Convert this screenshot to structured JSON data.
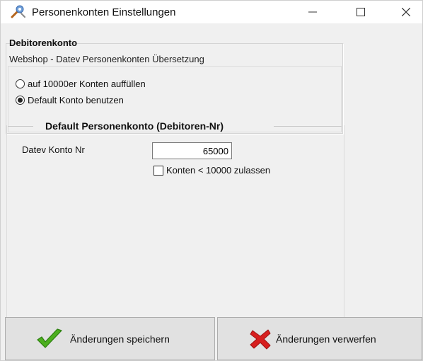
{
  "window": {
    "title": "Personenkonten Einstellungen",
    "icon": "wrench-settings-icon",
    "controls": {
      "minimize": "—",
      "maximize": "☐",
      "close": "✕"
    }
  },
  "debitor_group": {
    "title": "Debitorenkonto",
    "subtitle": "Webshop - Datev Personenkonten Übersetzung",
    "options": [
      {
        "label": "auf 10000er Konten auffüllen",
        "checked": false
      },
      {
        "label": "Default Konto benutzen",
        "checked": true
      }
    ]
  },
  "default_group": {
    "title": "Default Personenkonto (Debitoren-Nr)",
    "konto_label": "Datev Konto Nr",
    "konto_value": "65000",
    "allow_label": "Konten < 10000 zulassen",
    "allow_checked": false
  },
  "buttons": {
    "save_label": "Änderungen speichern",
    "save_icon": "green-checkmark-icon",
    "discard_label": "Änderungen verwerfen",
    "discard_icon": "red-x-icon"
  },
  "colors": {
    "save_icon": "#4caf1e",
    "discard_icon": "#d71f1f",
    "button_bg": "#e1e1e1",
    "window_bg": "#f0f0f0"
  }
}
